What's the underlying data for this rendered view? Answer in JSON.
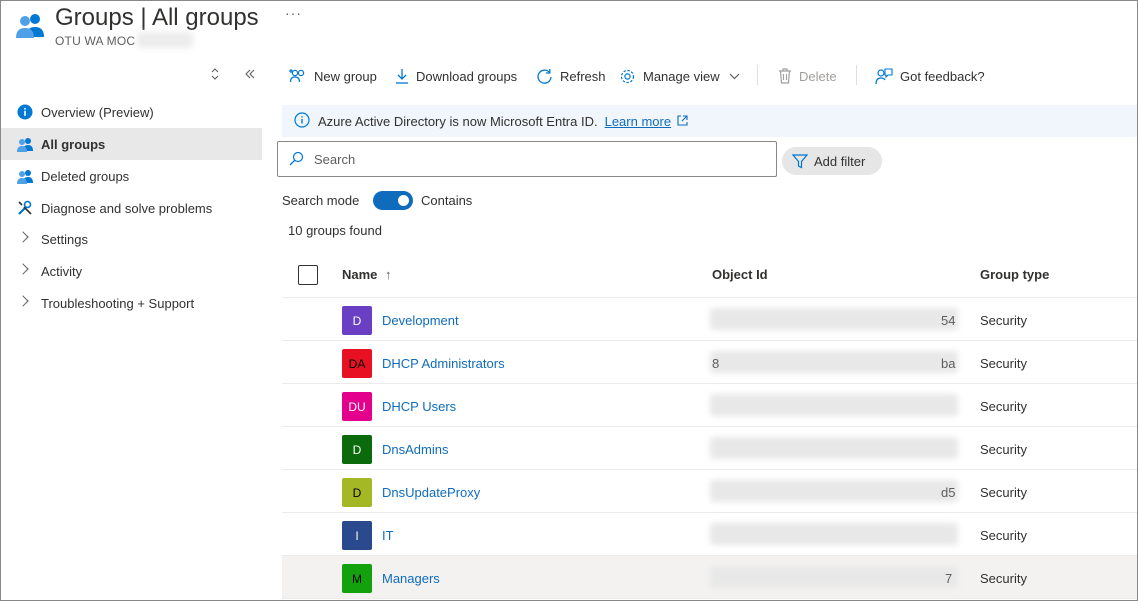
{
  "header": {
    "title": "Groups | All groups",
    "subtitle": "OTU WA MOC",
    "more": "···"
  },
  "sidebar": {
    "items": [
      {
        "label": "Overview (Preview)",
        "icon": "info-icon"
      },
      {
        "label": "All groups",
        "icon": "groups-icon",
        "active": true
      },
      {
        "label": "Deleted groups",
        "icon": "groups-icon"
      },
      {
        "label": "Diagnose and solve problems",
        "icon": "wrench-icon"
      },
      {
        "label": "Settings",
        "icon": "chevron-right-icon"
      },
      {
        "label": "Activity",
        "icon": "chevron-right-icon"
      },
      {
        "label": "Troubleshooting + Support",
        "icon": "chevron-right-icon"
      }
    ]
  },
  "toolbar": {
    "new_group": "New group",
    "download_groups": "Download groups",
    "refresh": "Refresh",
    "manage_view": "Manage view",
    "delete": "Delete",
    "feedback": "Got feedback?"
  },
  "banner": {
    "text": "Azure Active Directory is now Microsoft Entra ID.",
    "link": "Learn more"
  },
  "search": {
    "placeholder": "Search",
    "add_filter": "Add filter",
    "mode_label": "Search mode",
    "mode_value": "Contains",
    "mode_on": true
  },
  "results": {
    "count": "10 groups found"
  },
  "table": {
    "headers": {
      "name": "Name",
      "sort": "↑",
      "object_id": "Object Id",
      "group_type": "Group type"
    },
    "rows": [
      {
        "initials": "D",
        "name": "Development",
        "oid_prefix": "",
        "oid_suffix": "54",
        "type": "Security",
        "color": "#6b3fc4"
      },
      {
        "initials": "DA",
        "name": "DHCP Administrators",
        "oid_prefix": "8",
        "oid_suffix": "ba",
        "type": "Security",
        "color": "#e81123"
      },
      {
        "initials": "DU",
        "name": "DHCP Users",
        "oid_prefix": "",
        "oid_suffix": "",
        "type": "Security",
        "color": "#e3008c"
      },
      {
        "initials": "D",
        "name": "DnsAdmins",
        "oid_prefix": "",
        "oid_suffix": "",
        "type": "Security",
        "color": "#0b6a0b"
      },
      {
        "initials": "D",
        "name": "DnsUpdateProxy",
        "oid_prefix": "",
        "oid_suffix": "d5",
        "type": "Security",
        "color": "#a4b826"
      },
      {
        "initials": "I",
        "name": "IT",
        "oid_prefix": "",
        "oid_suffix": "",
        "type": "Security",
        "color": "#2b4a8e"
      },
      {
        "initials": "M",
        "name": "Managers",
        "oid_prefix": "",
        "oid_suffix": "7",
        "type": "Security",
        "color": "#13a10e"
      }
    ]
  },
  "colors": {
    "accent": "#0f6cbd",
    "banner_bg": "#f0f6fc",
    "selected_bg": "#e8e8e8"
  }
}
